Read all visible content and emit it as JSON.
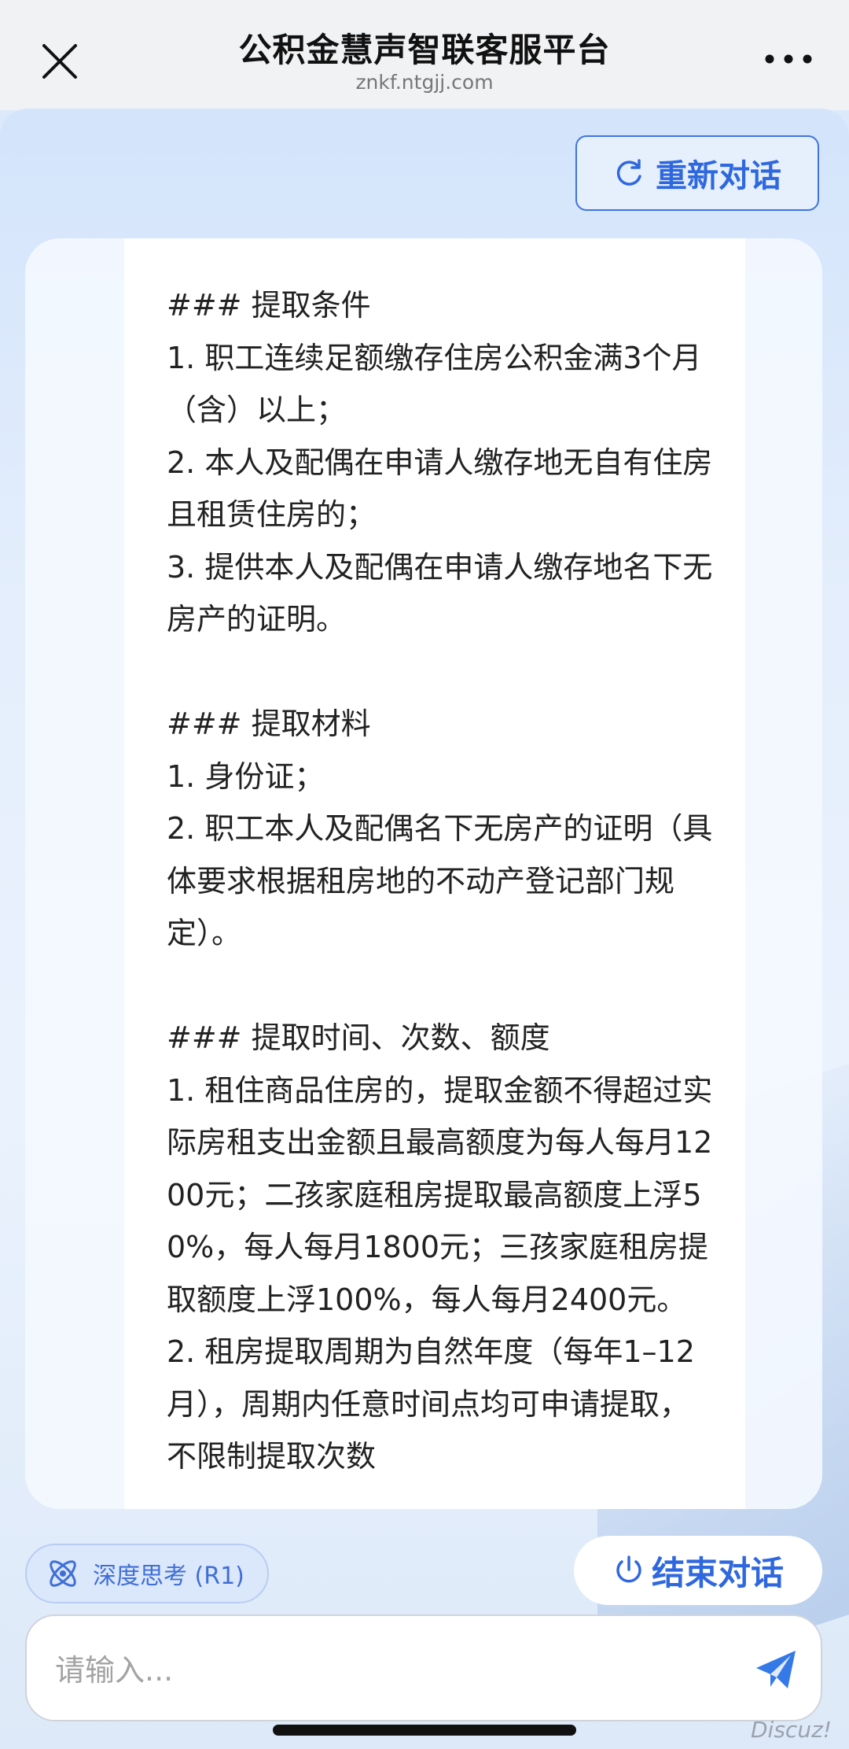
{
  "header": {
    "title": "公积金慧声智联客服平台",
    "subtitle": "znkf.ntgjj.com"
  },
  "toolbar": {
    "restart_label": "重新对话",
    "deep_think_label": "深度思考 (R1)",
    "end_label": "结束对话"
  },
  "message": {
    "text": "### 提取条件\n1. 职工连续足额缴存住房公积金满3个月（含）以上；\n2. 本人及配偶在申请人缴存地无自有住房且租赁住房的；\n3. 提供本人及配偶在申请人缴存地名下无房产的证明。\n\n### 提取材料\n1. 身份证；\n2. 职工本人及配偶名下无房产的证明（具体要求根据租房地的不动产登记部门规定）。\n\n### 提取时间、次数、额度\n1. 租住商品住房的，提取金额不得超过实际房租支出金额且最高额度为每人每月1200元；二孩家庭租房提取最高额度上浮50%，每人每月1800元；三孩家庭租房提取额度上浮100%，每人每月2400元。\n2. 租房提取周期为自然年度（每年1–12月），周期内任意时间点均可申请提取，不限制提取次数"
  },
  "input": {
    "placeholder": "请输入..."
  },
  "watermark": "Discuz!",
  "colors": {
    "accent": "#2f68de",
    "header_bg": "#f1f2f4",
    "page_bg": "#dbe9fb"
  },
  "icons": {
    "close": "close-icon",
    "more": "more-dots-icon",
    "restart": "refresh-icon",
    "deep_think": "atom-icon",
    "end": "power-icon",
    "send": "send-plane-icon"
  }
}
